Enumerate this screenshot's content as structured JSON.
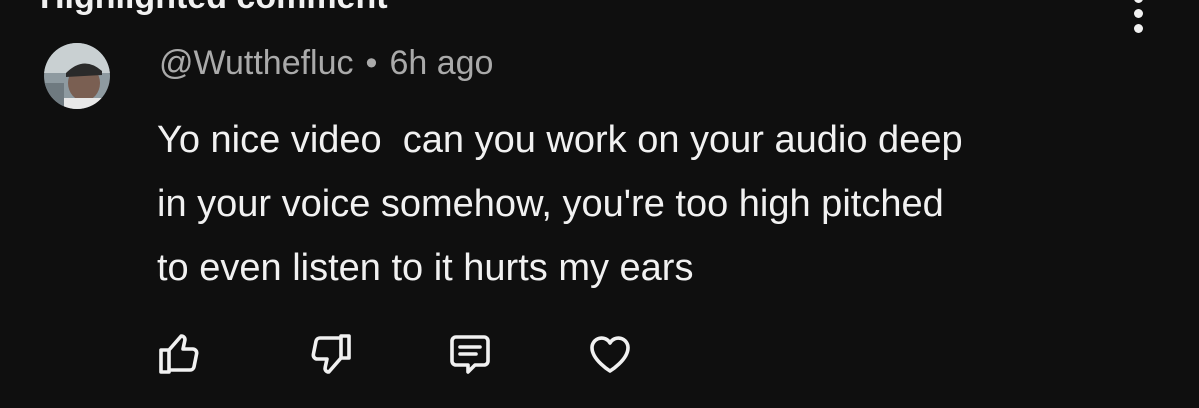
{
  "section": {
    "title": "Highlighted comment"
  },
  "comment": {
    "author": "@Wutthefluc",
    "separator": "•",
    "time": "6h ago",
    "lines": [
      "Yo nice video  can you work on your audio deep",
      "in your voice somehow, you're too high pitched",
      "to even listen to it hurts my ears"
    ]
  },
  "icons": {
    "like": "thumbs-up-icon",
    "dislike": "thumbs-down-icon",
    "reply": "reply-comment-icon",
    "heart": "heart-icon",
    "more": "more-vertical-icon"
  },
  "colors": {
    "background": "#0f0f0f",
    "text": "#f1f1f1",
    "meta": "#aaaaaa"
  }
}
